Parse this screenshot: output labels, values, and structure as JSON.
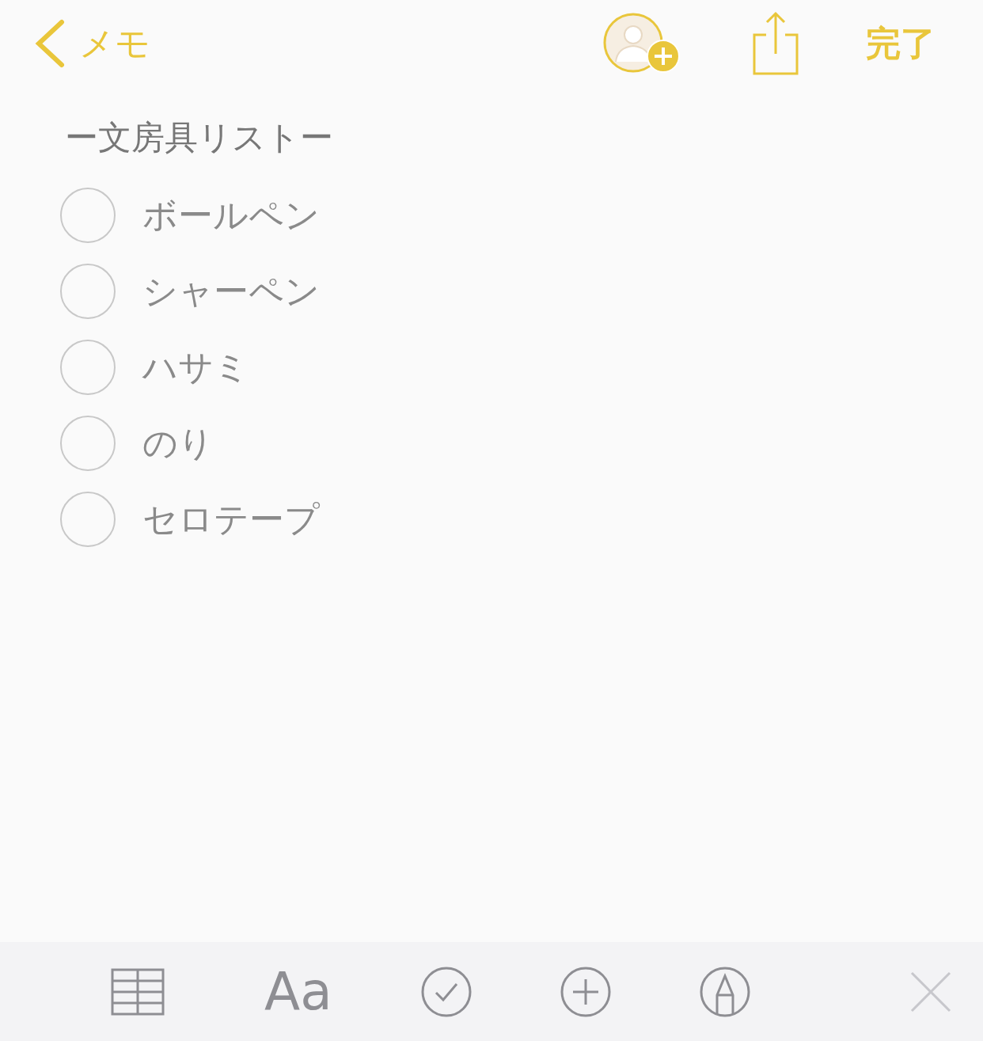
{
  "nav": {
    "back_label": "メモ",
    "done_label": "完了"
  },
  "note": {
    "title": "ー文房具リストー",
    "checklist": [
      {
        "text": "ボールペン",
        "checked": false
      },
      {
        "text": "シャーペン",
        "checked": false
      },
      {
        "text": "ハサミ",
        "checked": false
      },
      {
        "text": "のり",
        "checked": false
      },
      {
        "text": "セロテープ",
        "checked": false
      }
    ]
  },
  "toolbar": {
    "format_label": "Aa"
  }
}
